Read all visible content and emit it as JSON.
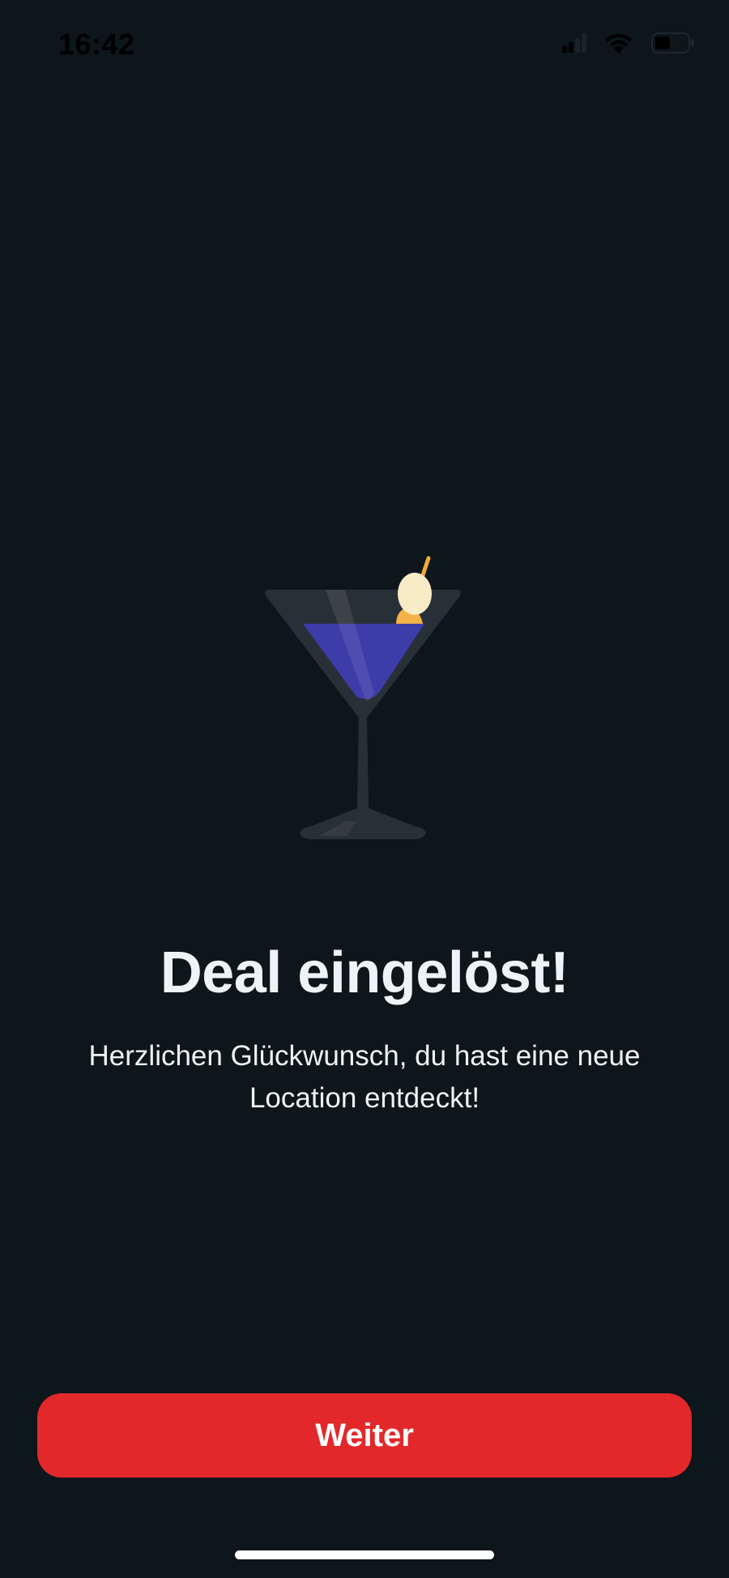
{
  "status_bar": {
    "time": "16:42",
    "icons": [
      "signal-icon",
      "wifi-icon",
      "battery-icon"
    ]
  },
  "illustration": {
    "icon": "martini-glass-icon",
    "colors": {
      "glass": "#283037",
      "drink": "#3e3ca8",
      "olive": "#f8ecc6",
      "pick": "#f2a93a"
    }
  },
  "success": {
    "title": "Deal eingelöst!",
    "message": "Herzlichen Glückwunsch, du hast eine neue Location entdeckt!"
  },
  "actions": {
    "continue_label": "Weiter"
  },
  "theme": {
    "background": "#0d161b",
    "accent": "#e2282b",
    "text": "#eef3f5"
  }
}
